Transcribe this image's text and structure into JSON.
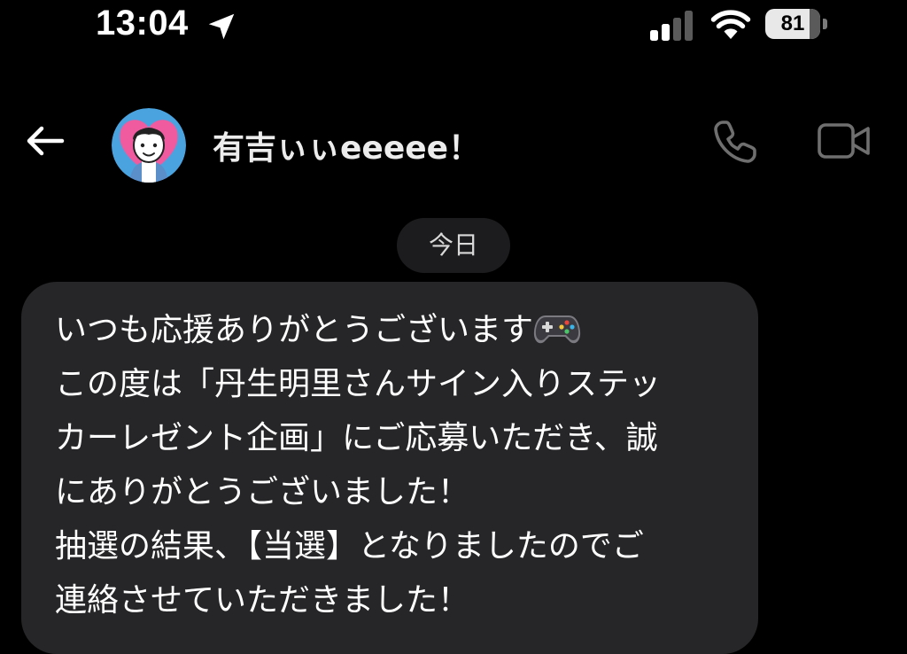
{
  "status_bar": {
    "time": "13:04",
    "battery_level": "81",
    "battery_fraction": 0.81,
    "icons": [
      "location-arrow-icon",
      "cellular-signal-icon",
      "wifi-icon",
      "battery-icon"
    ]
  },
  "header": {
    "contact_name": "有吉ぃぃeeeee！",
    "icons": [
      "back-arrow-icon",
      "avatar",
      "phone-icon",
      "video-camera-icon"
    ]
  },
  "date_separator": "今日",
  "message": {
    "lines": [
      "いつも応援ありがとうございます",
      "この度は「丹生明里さんサイン入りステッ",
      "カーレゼント企画」にご応募いただき、誠",
      "にありがとうございました！",
      "抽選の結果、【当選】となりましたのでご",
      "連絡させていただきました！"
    ],
    "emoji_icon": "video-game-controller-icon"
  },
  "colors": {
    "background": "#000000",
    "bubble": "#262628",
    "pill": "#1c1c1e",
    "avatar_ring": "#4aa3df",
    "avatar_heart": "#f05a9e"
  }
}
